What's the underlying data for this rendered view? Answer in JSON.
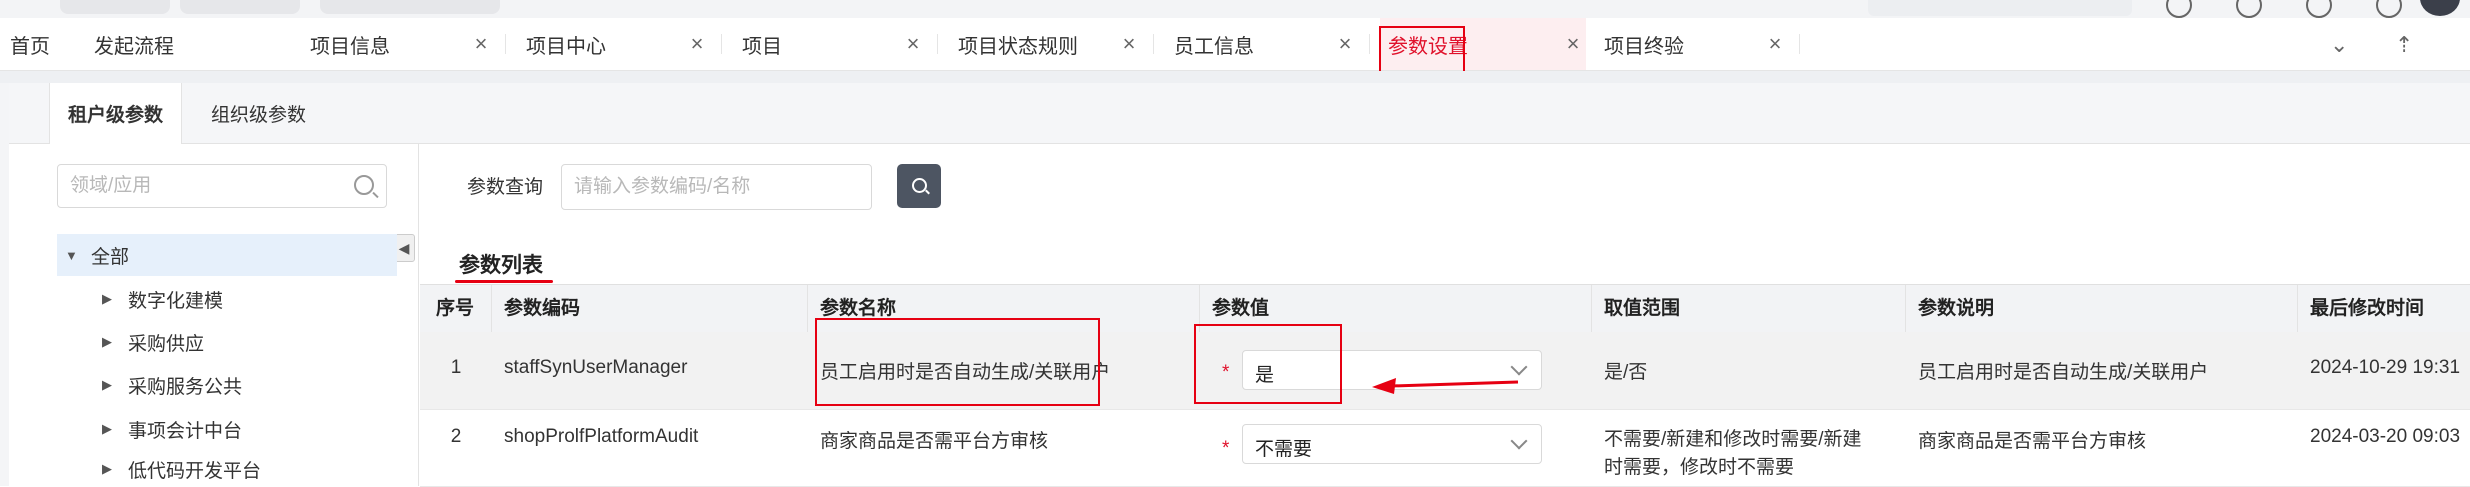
{
  "tabs": [
    {
      "label": "首页",
      "closable": false
    },
    {
      "label": "发起流程",
      "closable": false
    },
    {
      "label": "项目信息",
      "closable": true
    },
    {
      "label": "项目中心",
      "closable": true
    },
    {
      "label": "项目",
      "closable": true
    },
    {
      "label": "项目状态规则",
      "closable": true
    },
    {
      "label": "员工信息",
      "closable": true
    },
    {
      "label": "参数设置",
      "closable": true,
      "active": true
    },
    {
      "label": "项目终验",
      "closable": true
    }
  ],
  "close_glyph": "×",
  "subtabs": [
    "租户级参数",
    "组织级参数"
  ],
  "tree": {
    "search_placeholder": "领域/应用",
    "root": "全部",
    "items": [
      "数字化建模",
      "采购供应",
      "采购服务公共",
      "事项会计中台",
      "低代码开发平台"
    ]
  },
  "query": {
    "label": "参数查询",
    "placeholder": "请输入参数编码/名称"
  },
  "list_title": "参数列表",
  "table": {
    "headers": [
      "序号",
      "参数编码",
      "参数名称",
      "参数值",
      "取值范围",
      "参数说明",
      "最后修改时间"
    ],
    "rows": [
      {
        "index": "1",
        "code": "staffSynUserManager",
        "name": "员工启用时是否自动生成/关联用户",
        "value": "是",
        "range": "是/否",
        "desc": "员工启用时是否自动生成/关联用户",
        "time": "2024-10-29 19:31"
      },
      {
        "index": "2",
        "code": "shopProlfPlatformAudit",
        "name": "商家商品是否需平台方审核",
        "value": "不需要",
        "range_line1": "不需要/新建和修改时需要/新建",
        "range_line2": "时需要，修改时不需要",
        "desc": "商家商品是否需平台方审核",
        "time": "2024-03-20 09:03"
      }
    ]
  },
  "required_mark": "*",
  "colors": {
    "accent_red": "#e60012",
    "active_tab_text": "#e0112b",
    "search_button": "#4d5562"
  }
}
